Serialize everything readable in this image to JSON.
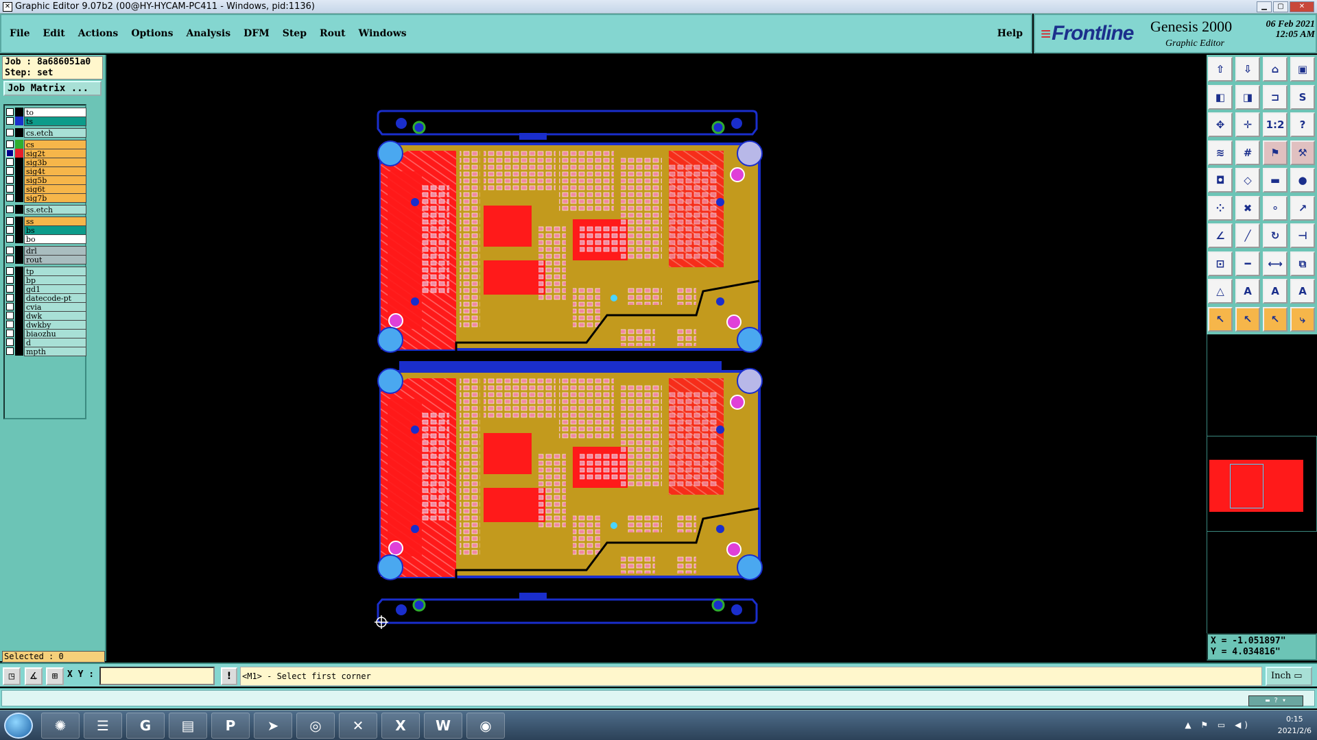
{
  "window": {
    "title": "Graphic Editor 9.07b2 (00@HY-HYCAM-PC411 - Windows, pid:1136)"
  },
  "menu": {
    "items": [
      "File",
      "Edit",
      "Actions",
      "Options",
      "Analysis",
      "DFM",
      "Step",
      "Rout",
      "Windows"
    ],
    "help": "Help"
  },
  "brand": {
    "logo": "Frontline",
    "product": "Genesis 2000",
    "subtitle": "Graphic Editor",
    "date": "06 Feb 2021",
    "time": "12:05 AM"
  },
  "job": {
    "job_line": "Job : 8a686051a0",
    "step_line": "Step: set",
    "matrix_button": "Job Matrix ..."
  },
  "layers": [
    {
      "name": "to",
      "swatch": "#000000",
      "bg": "#ffffff",
      "checked": false
    },
    {
      "name": "ts",
      "swatch": "#1a2ecc",
      "bg": "#0d9b8a",
      "checked": false
    },
    {
      "name": "cs.etch",
      "swatch": "#000000",
      "bg": "#a8e0d6",
      "checked": false
    },
    {
      "name": "cs",
      "swatch": "#2fae2f",
      "bg": "#f6b64a",
      "checked": false
    },
    {
      "name": "sig2t",
      "swatch": "#e8202a",
      "bg": "#f6b64a",
      "checked": true
    },
    {
      "name": "sig3b",
      "swatch": "#000000",
      "bg": "#f6b64a",
      "checked": false
    },
    {
      "name": "sig4t",
      "swatch": "#000000",
      "bg": "#f6b64a",
      "checked": false
    },
    {
      "name": "sig5b",
      "swatch": "#000000",
      "bg": "#f6b64a",
      "checked": false
    },
    {
      "name": "sig6t",
      "swatch": "#000000",
      "bg": "#f6b64a",
      "checked": false
    },
    {
      "name": "sig7b",
      "swatch": "#000000",
      "bg": "#f6b64a",
      "checked": false
    },
    {
      "name": "ss.etch",
      "swatch": "#000000",
      "bg": "#a8e0d6",
      "checked": false
    },
    {
      "name": "ss",
      "swatch": "#000000",
      "bg": "#f6b64a",
      "checked": false
    },
    {
      "name": "bs",
      "swatch": "#000000",
      "bg": "#0d9b8a",
      "checked": false
    },
    {
      "name": "bo",
      "swatch": "#000000",
      "bg": "#ffffff",
      "checked": false
    },
    {
      "name": "drl",
      "swatch": "#000000",
      "bg": "#a9bdbf",
      "checked": false
    },
    {
      "name": "rout",
      "swatch": "#000000",
      "bg": "#a9bdbf",
      "checked": false
    },
    {
      "name": "tp",
      "swatch": "#000000",
      "bg": "#a8e0d6",
      "checked": false
    },
    {
      "name": "bp",
      "swatch": "#000000",
      "bg": "#a8e0d6",
      "checked": false
    },
    {
      "name": "gd1",
      "swatch": "#000000",
      "bg": "#a8e0d6",
      "checked": false
    },
    {
      "name": "datecode-pt",
      "swatch": "#000000",
      "bg": "#a8e0d6",
      "checked": false
    },
    {
      "name": "cvia",
      "swatch": "#000000",
      "bg": "#a8e0d6",
      "checked": false
    },
    {
      "name": "dwk",
      "swatch": "#000000",
      "bg": "#a8e0d6",
      "checked": false
    },
    {
      "name": "dwkby",
      "swatch": "#000000",
      "bg": "#a8e0d6",
      "checked": false
    },
    {
      "name": "biaozhu",
      "swatch": "#000000",
      "bg": "#a8e0d6",
      "checked": false
    },
    {
      "name": "d",
      "swatch": "#000000",
      "bg": "#a8e0d6",
      "checked": false
    },
    {
      "name": "mpth",
      "swatch": "#000000",
      "bg": "#a8e0d6",
      "checked": false
    }
  ],
  "selected": "Selected : 0",
  "coords": {
    "x": "X = -1.051897\"",
    "y": "Y = 4.034816\""
  },
  "command": {
    "xy_label": "X Y :",
    "xy_value": "",
    "message": "<M1> - Select first corner",
    "unit": "Inch"
  },
  "tools": [
    {
      "icon": "zoom-in-icon",
      "glyph": "⇧",
      "style": "white"
    },
    {
      "icon": "zoom-out-icon",
      "glyph": "⇩",
      "style": "white"
    },
    {
      "icon": "home-icon",
      "glyph": "⌂",
      "style": "white"
    },
    {
      "icon": "window-icon",
      "glyph": "▣",
      "style": "white"
    },
    {
      "icon": "pan-left-icon",
      "glyph": "◧",
      "style": "white"
    },
    {
      "icon": "pan-right-icon",
      "glyph": "◨",
      "style": "white"
    },
    {
      "icon": "split-icon",
      "glyph": "⊐",
      "style": "white"
    },
    {
      "icon": "spline-icon",
      "glyph": "S",
      "style": "white"
    },
    {
      "icon": "fit-icon",
      "glyph": "✥",
      "style": "white"
    },
    {
      "icon": "center-icon",
      "glyph": "✛",
      "style": "white"
    },
    {
      "icon": "ratio-icon",
      "glyph": "1:2",
      "style": "white"
    },
    {
      "icon": "help-icon",
      "glyph": "?",
      "style": "white"
    },
    {
      "icon": "layers-icon",
      "glyph": "≋",
      "style": "white"
    },
    {
      "icon": "grid-icon",
      "glyph": "#",
      "style": "white"
    },
    {
      "icon": "drc-icon",
      "glyph": "⚑",
      "style": "red"
    },
    {
      "icon": "measure-icon",
      "glyph": "⚒",
      "style": "red"
    },
    {
      "icon": "pad-icon",
      "glyph": "◘",
      "style": "white"
    },
    {
      "icon": "shape-icon",
      "glyph": "◇",
      "style": "white"
    },
    {
      "icon": "ruler-icon",
      "glyph": "▬",
      "style": "white"
    },
    {
      "icon": "dot-icon",
      "glyph": "●",
      "style": "white"
    },
    {
      "icon": "node-icon",
      "glyph": "⁘",
      "style": "white"
    },
    {
      "icon": "cross-icon",
      "glyph": "✖",
      "style": "white"
    },
    {
      "icon": "connect-icon",
      "glyph": "⚬",
      "style": "white"
    },
    {
      "icon": "link-icon",
      "glyph": "↗",
      "style": "white"
    },
    {
      "icon": "angle-icon",
      "glyph": "∠",
      "style": "white"
    },
    {
      "icon": "line-icon",
      "glyph": "╱",
      "style": "white"
    },
    {
      "icon": "arc-icon",
      "glyph": "↻",
      "style": "white"
    },
    {
      "icon": "bus-icon",
      "glyph": "⊣",
      "style": "white"
    },
    {
      "icon": "move-icon",
      "glyph": "⊡",
      "style": "white"
    },
    {
      "icon": "minus-icon",
      "glyph": "━",
      "style": "white"
    },
    {
      "icon": "dimension-icon",
      "glyph": "⟷",
      "style": "white"
    },
    {
      "icon": "copy-icon",
      "glyph": "⧉",
      "style": "white"
    },
    {
      "icon": "triangle-icon",
      "glyph": "△",
      "style": "white"
    },
    {
      "icon": "font-icon",
      "glyph": "A",
      "style": "white"
    },
    {
      "icon": "text-icon",
      "glyph": "A",
      "style": "white"
    },
    {
      "icon": "text-bold-icon",
      "glyph": "A",
      "style": "white"
    },
    {
      "icon": "pointer-icon",
      "glyph": "↖",
      "style": "yellow"
    },
    {
      "icon": "select-icon",
      "glyph": "↖",
      "style": "yellow"
    },
    {
      "icon": "select-net-icon",
      "glyph": "↖",
      "style": "yellow"
    },
    {
      "icon": "route-icon",
      "glyph": "⤷",
      "style": "yellow"
    }
  ],
  "taskbar": {
    "time": "0:15",
    "date": "2021/2/6",
    "apps": [
      {
        "icon": "shell-icon",
        "glyph": "✺"
      },
      {
        "icon": "notepad-icon",
        "glyph": "☰"
      },
      {
        "icon": "genesis-icon",
        "glyph": "G"
      },
      {
        "icon": "save-icon",
        "glyph": "▤"
      },
      {
        "icon": "p-app-icon",
        "glyph": "P"
      },
      {
        "icon": "bird-icon",
        "glyph": "➤"
      },
      {
        "icon": "eye-app-icon",
        "glyph": "◎"
      },
      {
        "icon": "x-app-icon",
        "glyph": "✕"
      },
      {
        "icon": "excel-icon",
        "glyph": "X"
      },
      {
        "icon": "word-icon",
        "glyph": "W"
      },
      {
        "icon": "cam-icon",
        "glyph": "◉"
      }
    ]
  }
}
